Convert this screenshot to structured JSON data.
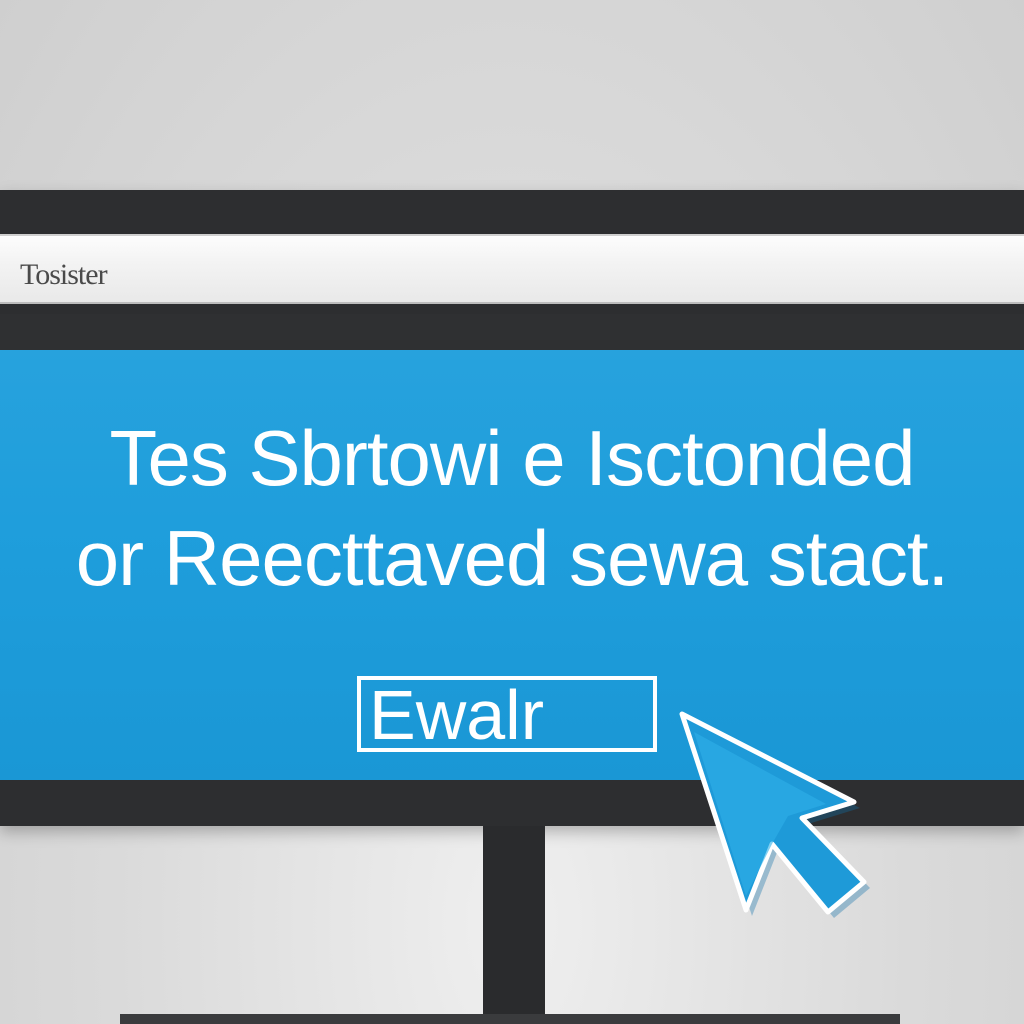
{
  "window": {
    "title": "Tosister"
  },
  "screen": {
    "message_line_1": "Tes Sbrtowi e Isctonded",
    "message_line_2": "or Reecttaved sewa stact.",
    "button_label": "Ewalr"
  },
  "colors": {
    "screen_blue": "#1f9edc",
    "monitor_frame": "#2d2e30",
    "title_bar": "#f3f3f3",
    "cursor_blue": "#1e9ad8"
  },
  "icons": {
    "cursor": "mouse-pointer-icon"
  }
}
